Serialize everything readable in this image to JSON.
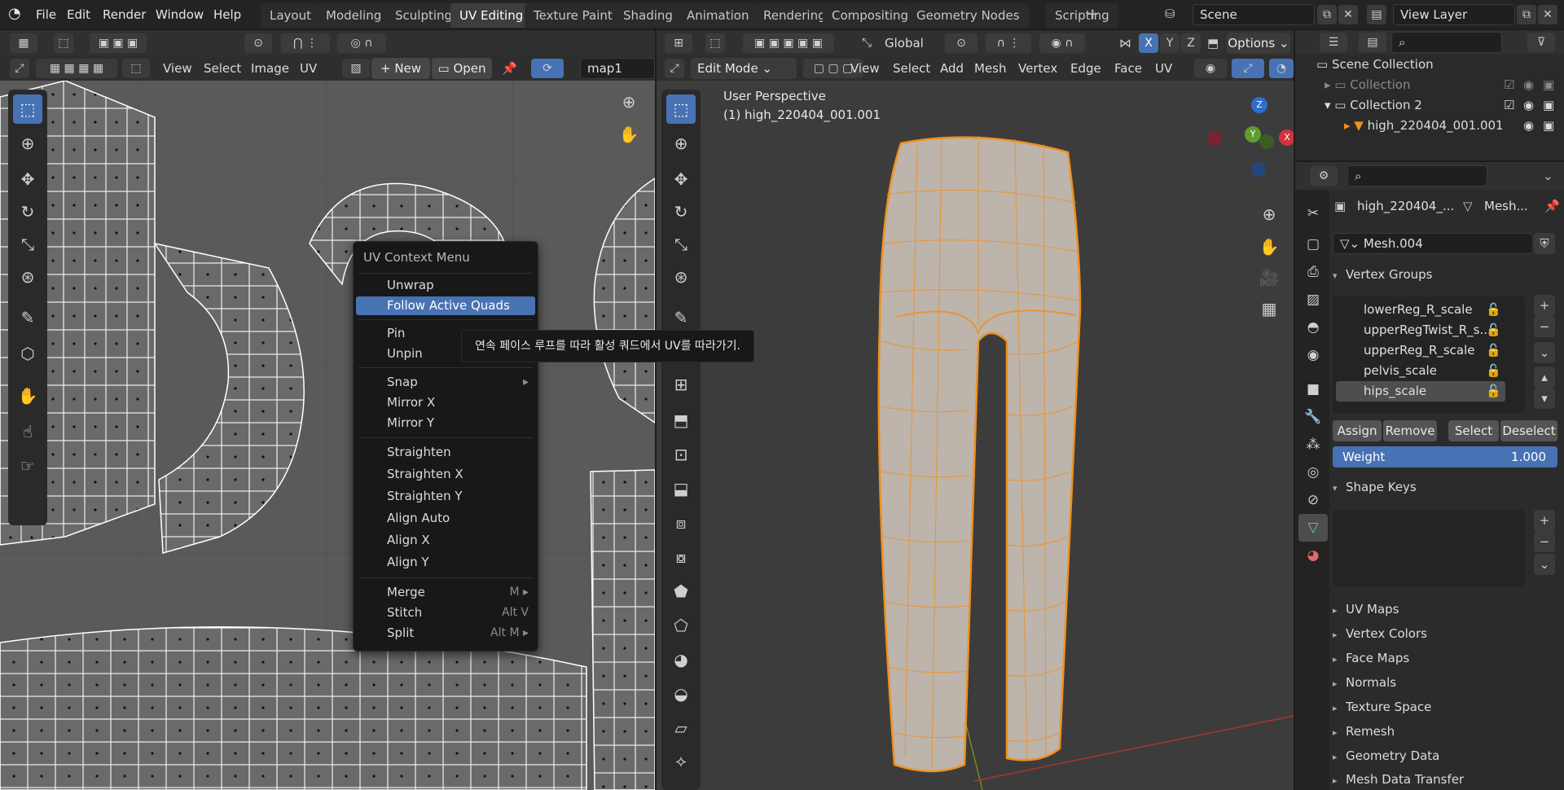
{
  "topbar": {
    "menus": [
      "File",
      "Edit",
      "Render",
      "Window",
      "Help"
    ],
    "workspace_tabs": [
      "Layout",
      "Modeling",
      "Sculpting",
      "UV Editing",
      "Texture Paint",
      "Shading",
      "Animation",
      "Rendering",
      "Compositing",
      "Geometry Nodes",
      "Scripting"
    ],
    "active_tab": "UV Editing",
    "scene_name": "Scene",
    "view_layer_name": "View Layer"
  },
  "uv_editor": {
    "header_menus": [
      "View",
      "Select",
      "Image",
      "UV"
    ],
    "new_label": "New",
    "open_label": "Open",
    "uv_map_name": "map1"
  },
  "context_menu": {
    "title": "UV Context Menu",
    "items": [
      {
        "label": "Unwrap",
        "shortcut": ""
      },
      {
        "label": "Follow Active Quads",
        "shortcut": ""
      },
      {
        "label": "Pin",
        "shortcut": ""
      },
      {
        "label": "Unpin",
        "shortcut": ""
      },
      {
        "label": "Snap",
        "shortcut": "▸"
      },
      {
        "label": "Mirror X",
        "shortcut": ""
      },
      {
        "label": "Mirror Y",
        "shortcut": ""
      },
      {
        "label": "Straighten",
        "shortcut": ""
      },
      {
        "label": "Straighten X",
        "shortcut": ""
      },
      {
        "label": "Straighten Y",
        "shortcut": ""
      },
      {
        "label": "Align Auto",
        "shortcut": ""
      },
      {
        "label": "Align X",
        "shortcut": ""
      },
      {
        "label": "Align Y",
        "shortcut": ""
      },
      {
        "label": "Merge",
        "shortcut": "M ▸"
      },
      {
        "label": "Stitch",
        "shortcut": "Alt V"
      },
      {
        "label": "Split",
        "shortcut": "Alt M ▸"
      }
    ],
    "highlighted": "Follow Active Quads",
    "tooltip": "연속 페이스 루프를 따라 활성 쿼드에서 UV를 따라가기."
  },
  "viewport": {
    "transform_orientation": "Global",
    "options_label": "Options",
    "mode": "Edit Mode",
    "header_menus": [
      "View",
      "Select",
      "Add",
      "Mesh",
      "Vertex",
      "Edge",
      "Face",
      "UV"
    ],
    "axis_toggles": [
      "X",
      "Y",
      "Z"
    ],
    "view_name": "User Perspective",
    "object_label": "(1) high_220404_001.001"
  },
  "outliner": {
    "root": "Scene Collection",
    "rows": [
      {
        "label": "Collection"
      },
      {
        "label": "Collection 2"
      },
      {
        "label": "high_220404_001.001"
      }
    ]
  },
  "properties": {
    "object_name": "high_220404_...",
    "data_label": "Mesh...",
    "mesh_name": "Mesh.004",
    "vertex_groups_title": "Vertex Groups",
    "vertex_groups": [
      "lowerReg_R_scale",
      "upperRegTwist_R_s...",
      "upperReg_R_scale",
      "pelvis_scale",
      "hips_scale"
    ],
    "active_group": "hips_scale",
    "buttons": {
      "assign": "Assign",
      "remove": "Remove",
      "select": "Select",
      "deselect": "Deselect"
    },
    "weight_label": "Weight",
    "weight_value": "1.000",
    "shape_keys_title": "Shape Keys",
    "collapsed_sections": [
      "UV Maps",
      "Vertex Colors",
      "Face Maps",
      "Normals",
      "Texture Space",
      "Remesh",
      "Geometry Data",
      "Mesh Data Transfer"
    ]
  },
  "colors": {
    "accent": "#4772b3",
    "edit_outline": "#f0901e",
    "mesh_body": "#bdb4ac"
  }
}
